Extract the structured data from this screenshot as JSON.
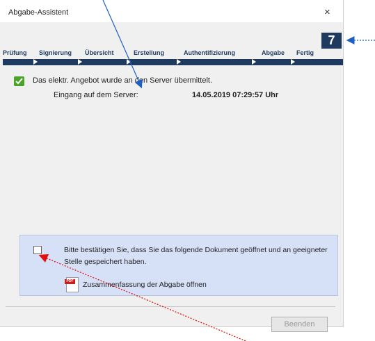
{
  "window": {
    "title": "Abgabe-Assistent",
    "close_glyph": "×",
    "step_number": "7"
  },
  "steps": [
    "Prüfung",
    "Signierung",
    "Übersicht",
    "Erstellung",
    "Authentifizierung",
    "Abgabe",
    "Fertig"
  ],
  "status": {
    "message": "Das elektr. Angebot wurde an den Server übermittelt.",
    "eingang_label": "Eingang auf dem Server:",
    "eingang_value": "14.05.2019 07:29:57 Uhr"
  },
  "confirm": {
    "text": "Bitte bestätigen Sie, dass Sie das folgende Dokument geöffnet und an geeigneter Stelle gespeichert haben.",
    "pdf_tag": "PDF",
    "link_label": "Zusammenfassung der Abgabe öffnen"
  },
  "buttons": {
    "finish": "Beenden"
  },
  "colors": {
    "accent": "#1e3a5f",
    "panel": "#d6e1f7",
    "success": "#4aa32a",
    "annotation_blue": "#1f5fbf",
    "annotation_red": "#e01010"
  },
  "icons": {
    "success": "check-icon",
    "document": "pdf-icon"
  }
}
